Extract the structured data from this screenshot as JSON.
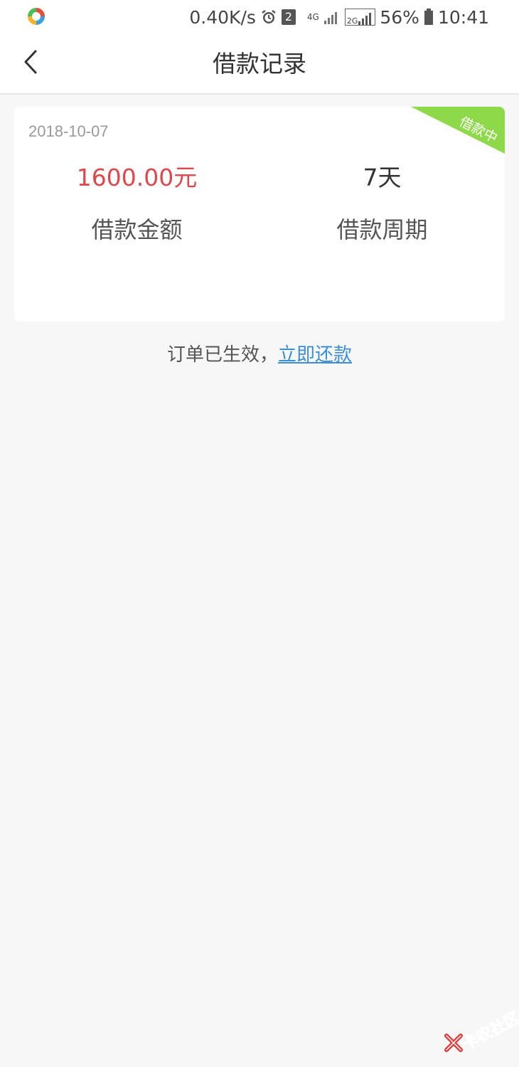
{
  "statusbar": {
    "speed": "0.40K/s",
    "sim_badge": "2",
    "network_4g": "4G",
    "network_2g": "2G",
    "battery": "56%",
    "time": "10:41"
  },
  "navbar": {
    "title": "借款记录"
  },
  "record": {
    "date": "2018-10-07",
    "status_tag": "借款中",
    "amount": "1600.00元",
    "amount_label": "借款金额",
    "period": "7天",
    "period_label": "借款周期"
  },
  "notice": {
    "text": "订单已生效，",
    "link": "立即还款"
  },
  "watermark": {
    "text": "卡农社区"
  },
  "colors": {
    "accent_red": "#e0474c",
    "link_blue": "#3b8fd8",
    "ribbon_green": "#8ed94a",
    "background": "#f7f7f7"
  },
  "icons": {
    "back": "chevron-left-icon",
    "alarm": "alarm-icon",
    "signal": "signal-icon",
    "battery": "battery-icon"
  }
}
